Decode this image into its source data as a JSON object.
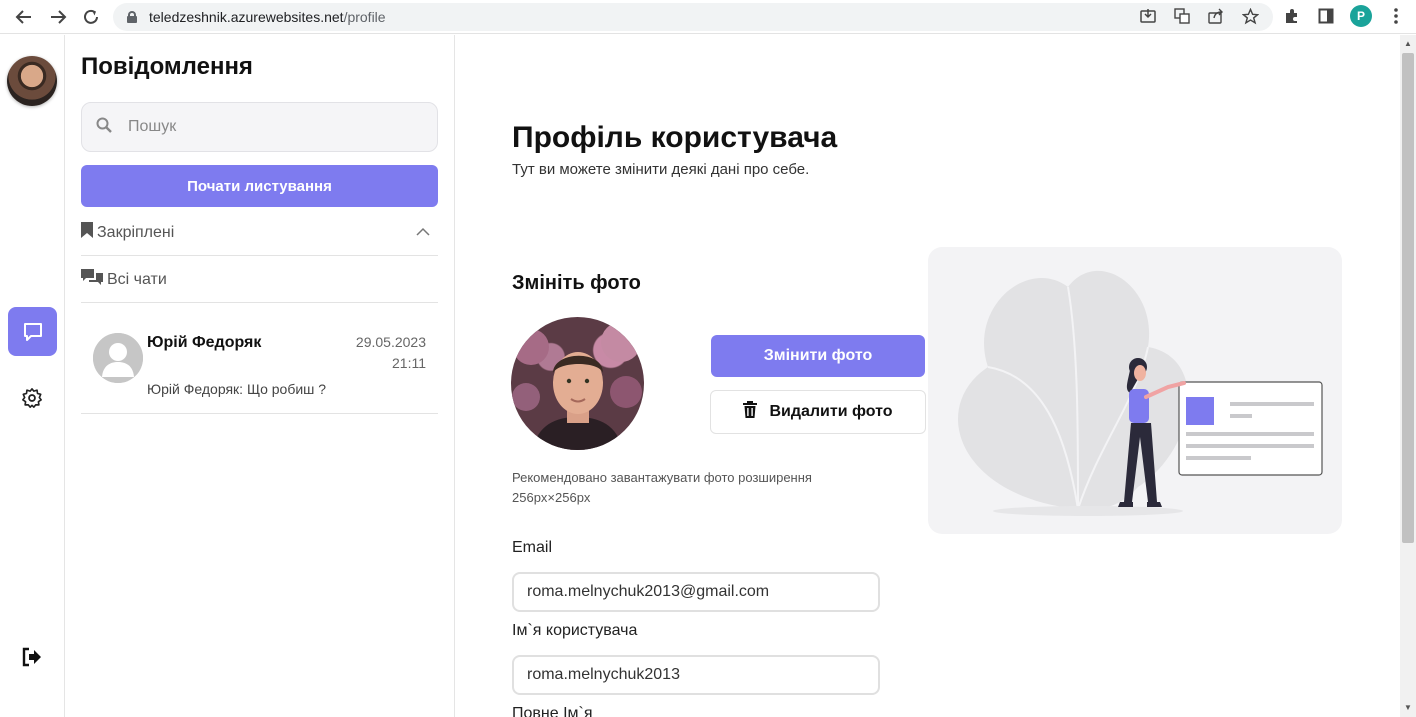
{
  "browser": {
    "url_host": "teledzeshnik.azurewebsites.net",
    "url_path": "/profile",
    "profile_initial": "P",
    "icons": [
      "back-icon",
      "forward-icon",
      "reload-icon",
      "lock-icon",
      "install-icon",
      "translate-icon",
      "share-icon",
      "star-icon",
      "extensions-icon",
      "side-panel-icon",
      "menu-icon"
    ]
  },
  "rail": {
    "icons": [
      "chat-icon",
      "gear-icon",
      "logout-icon"
    ],
    "accent": "#7e7bef"
  },
  "sidebar": {
    "title": "Повідомлення",
    "search_placeholder": "Пошук",
    "start_button": "Почати листування",
    "pinned_label": "Закріплені",
    "all_chats_label": "Всі чати",
    "chats": [
      {
        "name": "Юрій Федоряк",
        "date": "29.05.2023",
        "time": "21:11",
        "preview": "Юрій Федоряк: Що робиш ?"
      }
    ]
  },
  "profile": {
    "title": "Профіль користувача",
    "subtitle": "Тут ви можете змінити деякі дані про себе.",
    "photo_section_title": "Змініть фото",
    "change_photo_button": "Змінити фото",
    "delete_photo_button": "Видалити фото",
    "photo_hint": "Рекомендовано завантажувати фото розширення 256px×256px",
    "email_label": "Email",
    "email_value": "roma.melnychuk2013@gmail.com",
    "username_label": "Ім`я користувача",
    "username_value": "roma.melnychuk2013",
    "fullname_label": "Повне Ім`я"
  }
}
